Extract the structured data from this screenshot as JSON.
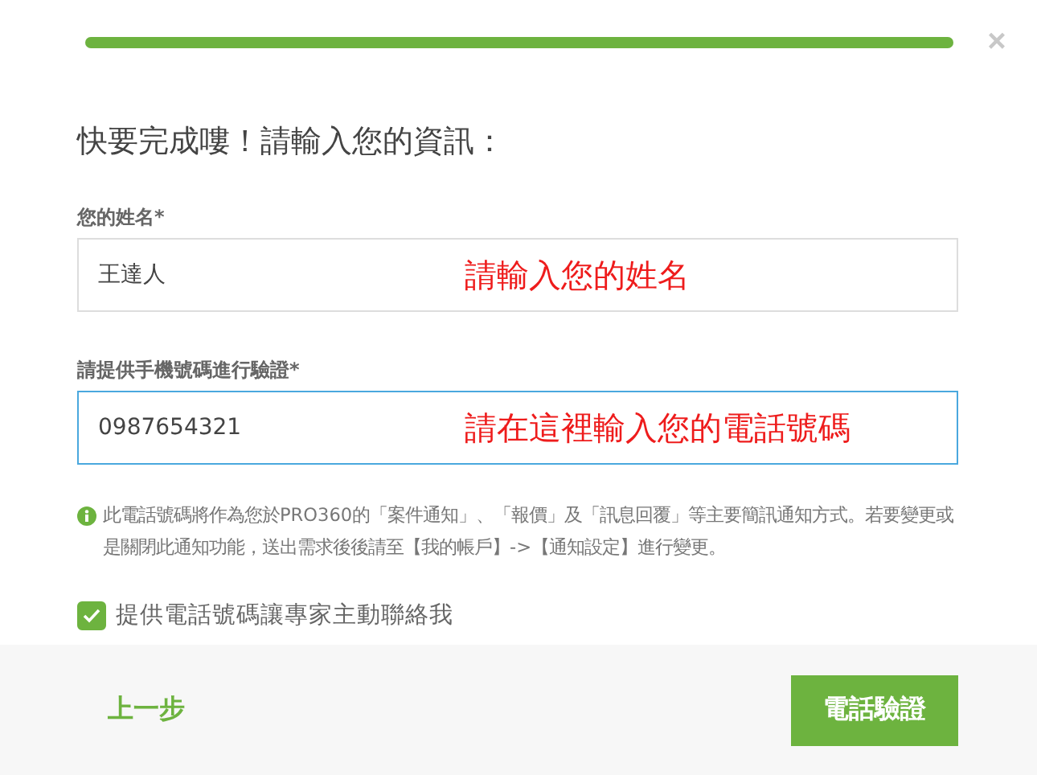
{
  "progress": {
    "level": 1
  },
  "close": "×",
  "heading": "快要完成嘍！請輸入您的資訊：",
  "fields": [
    {
      "label": "您的姓名*",
      "value": "王達人",
      "focused": false,
      "annotation": "請輸入您的姓名"
    },
    {
      "label": "請提供手機號碼進行驗證*",
      "value": "0987654321",
      "focused": true,
      "annotation": "請在這裡輸入您的電話號碼"
    }
  ],
  "note": "此電話號碼將作為您於PRO360的「案件通知」、「報價」及「訊息回覆」等主要簡訊通知方式。若要變更或是關閉此通知功能，送出需求後後請至【我的帳戶】->【通知設定】進行變更。",
  "checkbox": {
    "label": "提供電話號碼讓專家主動聯絡我",
    "checked": true
  },
  "footer": {
    "back": "上一步",
    "submit": "電話驗證"
  }
}
